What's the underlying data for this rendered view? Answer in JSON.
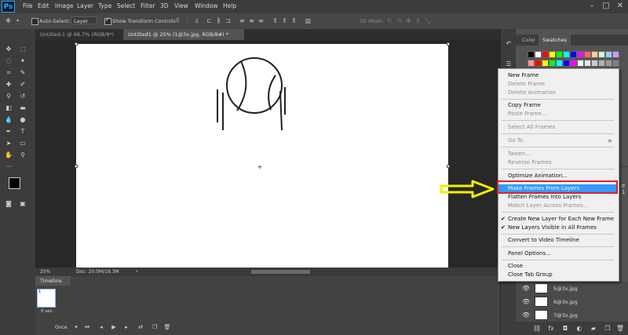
{
  "menubar": {
    "items": [
      "File",
      "Edit",
      "Image",
      "Layer",
      "Type",
      "Select",
      "Filter",
      "3D",
      "View",
      "Window",
      "Help"
    ],
    "logo": "Ps"
  },
  "options": {
    "auto_select": "Auto-Select:",
    "layer_select": "Layer",
    "show_transform": "Show Transform Controls",
    "mode_3d": "3D Mode:"
  },
  "tabs": [
    {
      "label": "Untitled-1 @ 66.7% (RGB/8*)",
      "active": false
    },
    {
      "label": "Untitled1 @ 25% (1@3x.jpg, RGB/8#) *",
      "active": true
    }
  ],
  "status": {
    "zoom": "25%",
    "doc": "Doc: 20.0M/19.3M"
  },
  "timeline": {
    "title": "Timeline",
    "frame_number": "1",
    "frame_delay": "0 sec.",
    "loop": "Once"
  },
  "right_panel": {
    "tab_color": "Color",
    "tab_swatches": "Swatches",
    "layers": [
      "5@3x.jpg",
      "6@3x.jpg",
      "7@3x.jpg"
    ],
    "right_edge_char": "e 1"
  },
  "flyout": {
    "items": [
      {
        "label": "New Frame",
        "disabled": false
      },
      {
        "label": "Delete Frame",
        "disabled": true
      },
      {
        "label": "Delete Animation",
        "disabled": true
      },
      {
        "label": "Copy Frame",
        "disabled": false
      },
      {
        "label": "Paste Frame...",
        "disabled": true
      },
      {
        "label": "Select All Frames",
        "disabled": true
      },
      {
        "label": "Go To",
        "disabled": true
      },
      {
        "label": "Tween...",
        "disabled": true
      },
      {
        "label": "Reverse Frames",
        "disabled": true
      },
      {
        "label": "Optimize Animation...",
        "disabled": false
      },
      {
        "label": "Make Frames From Layers",
        "disabled": false,
        "highlighted": true
      },
      {
        "label": "Flatten Frames Into Layers",
        "disabled": false
      },
      {
        "label": "Match Layer Across Frames...",
        "disabled": true
      },
      {
        "label": "Create New Layer for Each New Frame",
        "disabled": false,
        "checked": true
      },
      {
        "label": "New Layers Visible in All Frames",
        "disabled": false,
        "checked": true
      },
      {
        "label": "Convert to Video Timeline",
        "disabled": false
      },
      {
        "label": "Panel Options...",
        "disabled": false
      },
      {
        "label": "Close",
        "disabled": false
      },
      {
        "label": "Close Tab Group",
        "disabled": false
      }
    ]
  },
  "colors": {
    "highlight": "#3399ff",
    "annotation_red": "#e0212c",
    "annotation_arrow": "#f5f000",
    "swatches": [
      "#000000",
      "#ffffff",
      "#ff0000",
      "#ffff00",
      "#00ff00",
      "#00ffff",
      "#0000ff",
      "#ff00ff",
      "#ff6666",
      "#ffcc99",
      "#ccffcc",
      "#99ccff",
      "#cc99ff",
      "#ff9999",
      "#ff0000",
      "#ffff00",
      "#00ff00",
      "#00ffff",
      "#0000ff",
      "#ff00ff",
      "#ffffff",
      "#e6e6e6",
      "#cccccc",
      "#b3b3b3",
      "#999999",
      "#808080"
    ]
  }
}
